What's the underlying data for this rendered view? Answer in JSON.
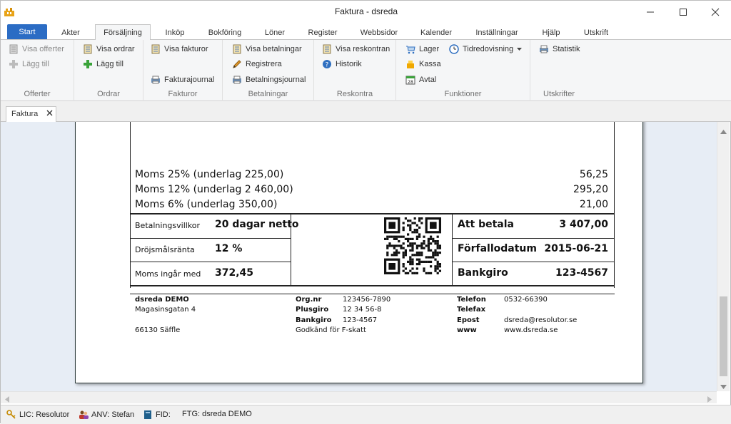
{
  "window": {
    "title": "Faktura - dsreda"
  },
  "tabs": [
    "Start",
    "Akter",
    "Försäljning",
    "Inköp",
    "Bokföring",
    "Löner",
    "Register",
    "Webbsidor",
    "Kalender",
    "Inställningar",
    "Hjälp",
    "Utskrift"
  ],
  "ribbon": {
    "offerter": {
      "label": "Offerter",
      "visa": "Visa offerter",
      "lagg": "Lägg till"
    },
    "ordrar": {
      "label": "Ordrar",
      "visa": "Visa ordrar",
      "lagg": "Lägg till"
    },
    "fakturor": {
      "label": "Fakturor",
      "visa": "Visa fakturor",
      "journal": "Fakturajournal"
    },
    "betalningar": {
      "label": "Betalningar",
      "visa": "Visa betalningar",
      "registrera": "Registrera",
      "journal": "Betalningsjournal"
    },
    "reskontra": {
      "label": "Reskontra",
      "visa": "Visa reskontran",
      "historik": "Historik"
    },
    "funktioner": {
      "label": "Funktioner",
      "lager": "Lager",
      "kassa": "Kassa",
      "avtal": "Avtal",
      "tidredovisning": "Tidredovisning"
    },
    "utskrifter": {
      "label": "Utskrifter",
      "statistik": "Statistik"
    }
  },
  "doctab": {
    "label": "Faktura"
  },
  "invoice": {
    "moms": [
      {
        "label": "Moms 25% (underlag 225,00)",
        "value": "56,25"
      },
      {
        "label": "Moms 12% (underlag 2 460,00)",
        "value": "295,20"
      },
      {
        "label": "Moms 6% (underlag 350,00)",
        "value": "21,00"
      }
    ],
    "terms": [
      {
        "label": "Betalningsvillkor",
        "value": "20 dagar netto"
      },
      {
        "label": "Dröjsmålsränta",
        "value": "12 %"
      },
      {
        "label": "Moms ingår med",
        "value": "372,45"
      }
    ],
    "totals": [
      {
        "label": "Att betala",
        "value": "3 407,00"
      },
      {
        "label": "Förfallodatum",
        "value": "2015-06-21"
      },
      {
        "label": "Bankgiro",
        "value": "123-4567"
      }
    ],
    "footer": {
      "company": "dsreda DEMO",
      "address": "Magasinsgatan 4",
      "city": "66130 Säffle",
      "orgnr_label": "Org.nr",
      "orgnr": "123456-7890",
      "plusgiro_label": "Plusgiro",
      "plusgiro": "12 34 56-8",
      "bankgiro_label": "Bankgiro",
      "bankgiro": "123-4567",
      "fskatt": "Godkänd för F-skatt",
      "telefon_label": "Telefon",
      "telefon": "0532-66390",
      "telefax_label": "Telefax",
      "epost_label": "Epost",
      "epost": "dsreda@resolutor.se",
      "www_label": "www",
      "www": "www.dsreda.se"
    }
  },
  "status": {
    "lic": "LIC: Resolutor",
    "anv": "ANV: Stefan",
    "fid": "FID:",
    "ftg": "FTG: dsreda DEMO"
  }
}
